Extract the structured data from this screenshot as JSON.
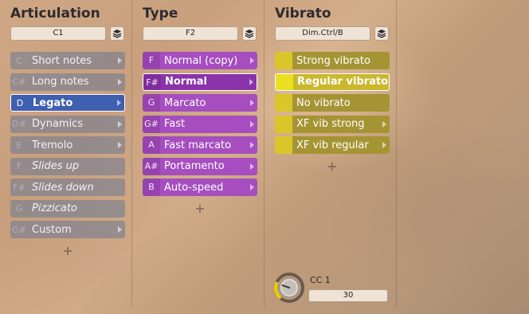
{
  "columns": [
    {
      "title": "Articulation",
      "selector": "C1",
      "items": [
        {
          "key": "C",
          "label": "Short notes",
          "italic": false,
          "selected": false
        },
        {
          "key": "C#",
          "label": "Long notes",
          "italic": false,
          "selected": false
        },
        {
          "key": "D",
          "label": "Legato",
          "italic": false,
          "selected": true
        },
        {
          "key": "D#",
          "label": "Dynamics",
          "italic": false,
          "selected": false
        },
        {
          "key": "E",
          "label": "Tremolo",
          "italic": false,
          "selected": false
        },
        {
          "key": "F",
          "label": "Slides up",
          "italic": true,
          "selected": false
        },
        {
          "key": "F#",
          "label": "Slides down",
          "italic": true,
          "selected": false
        },
        {
          "key": "G",
          "label": "Pizzicato",
          "italic": true,
          "selected": false
        },
        {
          "key": "G#",
          "label": "Custom",
          "italic": false,
          "selected": false
        }
      ]
    },
    {
      "title": "Type",
      "selector": "F2",
      "items": [
        {
          "key": "F",
          "label": "Normal (copy)",
          "selected": false
        },
        {
          "key": "F#",
          "label": "Normal",
          "selected": true
        },
        {
          "key": "G",
          "label": "Marcato",
          "selected": false
        },
        {
          "key": "G#",
          "label": "Fast",
          "selected": false
        },
        {
          "key": "A",
          "label": "Fast marcato",
          "selected": false
        },
        {
          "key": "A#",
          "label": "Portamento",
          "selected": false
        },
        {
          "key": "B",
          "label": "Auto-speed",
          "selected": false
        }
      ]
    },
    {
      "title": "Vibrato",
      "selector": "Dim.Ctrl/B",
      "items": [
        {
          "label": "Strong vibrato",
          "selected": false,
          "arrow": false
        },
        {
          "label": "Regular vibrato",
          "selected": true,
          "arrow": false
        },
        {
          "label": "No vibrato",
          "selected": false,
          "arrow": false
        },
        {
          "label": "XF vib strong",
          "selected": false,
          "arrow": true
        },
        {
          "label": "XF vib regular",
          "selected": false,
          "arrow": true
        }
      ]
    }
  ],
  "add_symbol": "+",
  "controller": {
    "label": "CC 1",
    "value": "30",
    "level": 30
  },
  "colors": {
    "articulation": "#697896",
    "articulation_selected": "#3f5fb0",
    "type": "#a64ec0",
    "type_selected": "#8a33aa",
    "vibrato": "#a59433",
    "vibrato_selected": "#cbb72d",
    "knob_ring": "#e8d000"
  }
}
